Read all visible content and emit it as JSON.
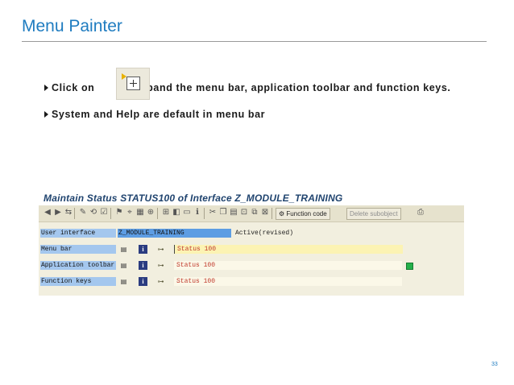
{
  "slide": {
    "title": "Menu Painter",
    "bullets": {
      "b1_pre": "Click on",
      "b1_post": "to expand the menu bar, application toolbar and function keys.",
      "b2": "System and Help are default in menu bar"
    },
    "page_number": "33"
  },
  "sap": {
    "heading": "Maintain Status STATUS100 of Interface Z_MODULE_TRAINING",
    "toolbar": {
      "function_code_label": "Function code",
      "delete_subobject_label": "Delete subobject"
    },
    "rows": {
      "user_interface": {
        "label": "User interface",
        "value": "Z_MODULE_TRAINING",
        "state": "Active(revised)"
      },
      "menu_bar": {
        "label": "Menu bar",
        "status": "Status 100"
      },
      "app_toolbar": {
        "label": "Application toolbar",
        "status": "Status 100"
      },
      "function_keys": {
        "label": "Function keys",
        "status": "Status 100"
      }
    }
  },
  "colors": {
    "title_blue": "#1f7cc0",
    "label_bg": "#a4c7ee",
    "interface_bg": "#5d9de3",
    "status_red": "#c0392b",
    "indicator_green": "#24b04a"
  },
  "icons": {
    "expand": "expand-icon",
    "help": "info-icon",
    "list": "list-icon",
    "tree": "hierarchy-icon"
  }
}
